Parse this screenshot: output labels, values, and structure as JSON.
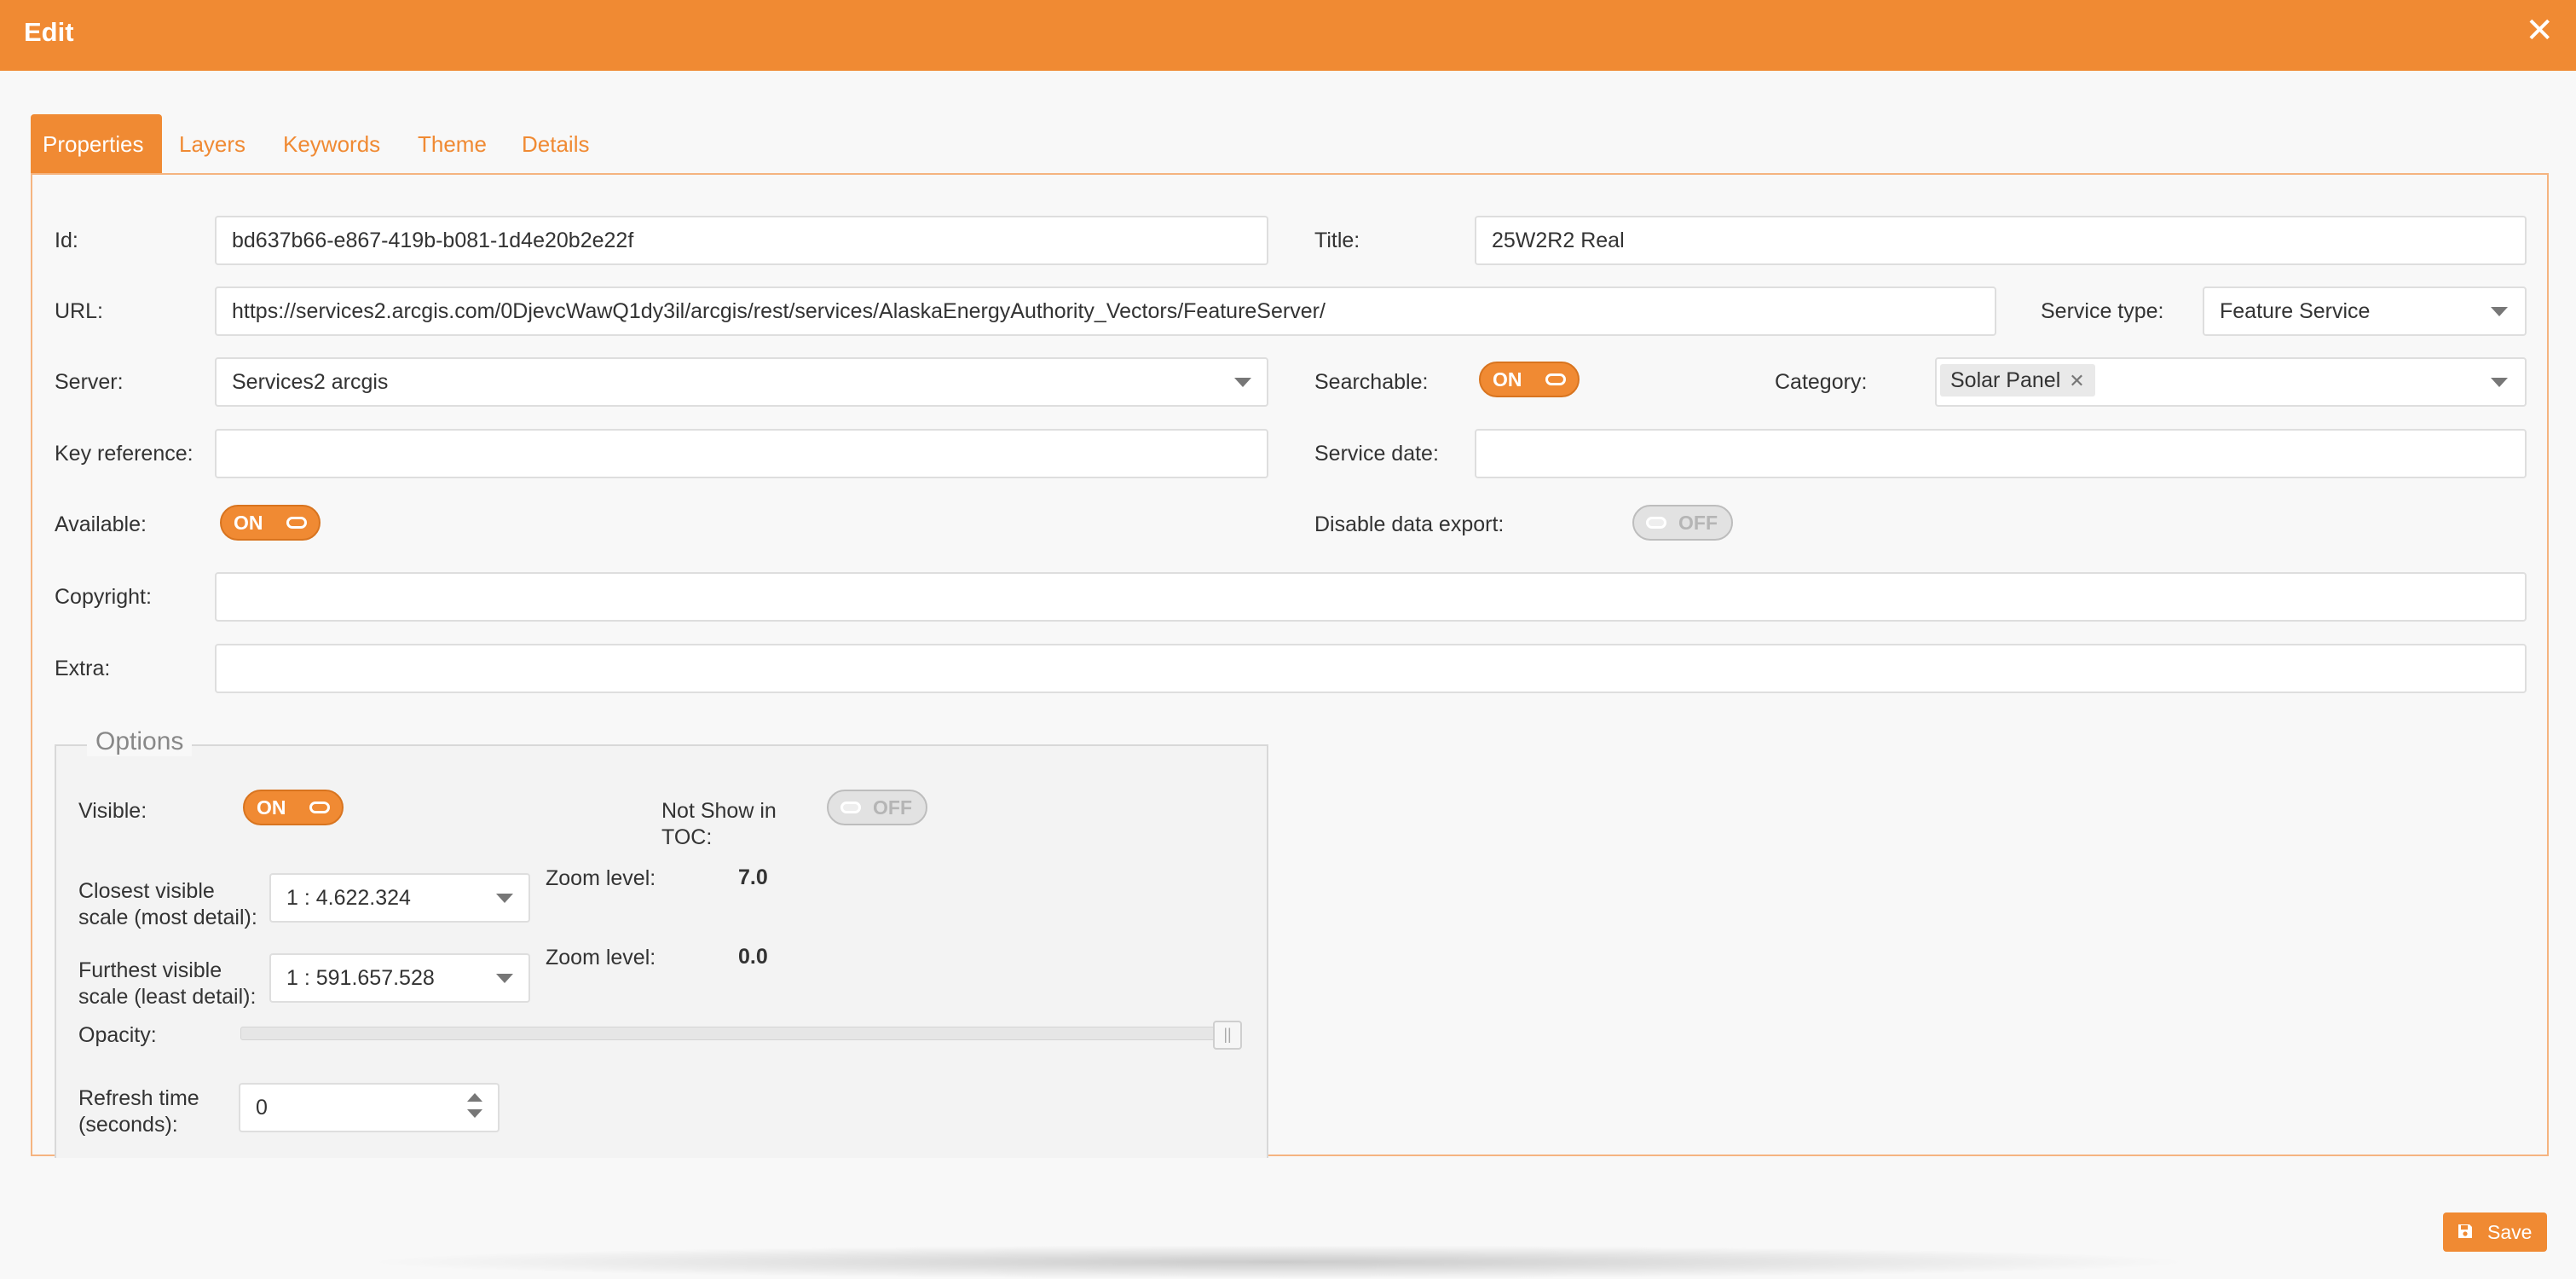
{
  "dialog": {
    "title": "Edit",
    "close_glyph": "✕"
  },
  "tabs": [
    {
      "label": "Properties",
      "active": true
    },
    {
      "label": "Layers",
      "active": false
    },
    {
      "label": "Keywords",
      "active": false
    },
    {
      "label": "Theme",
      "active": false
    },
    {
      "label": "Details",
      "active": false
    }
  ],
  "form": {
    "id": {
      "label": "Id:",
      "value": "bd637b66-e867-419b-b081-1d4e20b2e22f"
    },
    "title": {
      "label": "Title:",
      "value": "25W2R2 Real"
    },
    "url": {
      "label": "URL:",
      "value": "https://services2.arcgis.com/0DjevcWawQ1dy3il/arcgis/rest/services/AlaskaEnergyAuthority_Vectors/FeatureServer/"
    },
    "service_type": {
      "label": "Service type:",
      "value": "Feature Service"
    },
    "server": {
      "label": "Server:",
      "value": "Services2 arcgis"
    },
    "searchable": {
      "label": "Searchable:",
      "state": "ON"
    },
    "category": {
      "label": "Category:",
      "chip": "Solar Panel",
      "chip_remove": "✕"
    },
    "key_reference": {
      "label": "Key reference:",
      "value": ""
    },
    "service_date": {
      "label": "Service date:",
      "value": ""
    },
    "available": {
      "label": "Available:",
      "state": "ON"
    },
    "disable_export": {
      "label": "Disable data export:",
      "state": "OFF"
    },
    "copyright": {
      "label": "Copyright:",
      "value": ""
    },
    "extra": {
      "label": "Extra:",
      "value": ""
    }
  },
  "options": {
    "legend": "Options",
    "visible": {
      "label": "Visible:",
      "state": "ON"
    },
    "not_show_toc": {
      "label_line1": "Not Show in",
      "label_line2": "TOC:",
      "state": "OFF"
    },
    "closest_scale": {
      "label_line1": "Closest visible",
      "label_line2": "scale (most detail):",
      "value": "1 : 4.622.324",
      "zoom_label": "Zoom level:",
      "zoom_value": "7.0"
    },
    "furthest_scale": {
      "label_line1": "Furthest visible",
      "label_line2": "scale (least detail):",
      "value": "1 : 591.657.528",
      "zoom_label": "Zoom level:",
      "zoom_value": "0.0"
    },
    "opacity": {
      "label": "Opacity:",
      "value": 1.0,
      "handle_glyph": "||"
    },
    "refresh": {
      "label_line1": "Refresh time",
      "label_line2": "(seconds):",
      "value": "0"
    }
  },
  "footer": {
    "save_label": "Save"
  },
  "colors": {
    "accent": "#f08a33",
    "panel_border": "#f5b480"
  }
}
